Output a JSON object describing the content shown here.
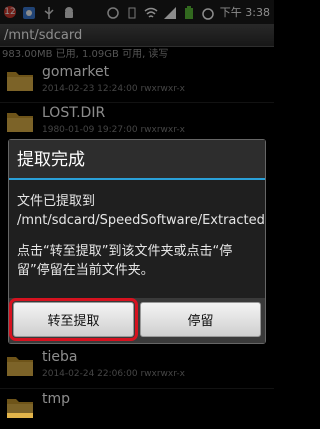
{
  "status_bar": {
    "notification_count": "12",
    "time": "下午 3:38",
    "icons": [
      "notification-badge-icon",
      "app-icon",
      "usb-icon",
      "android-icon",
      "sync-icon",
      "vibrate-icon",
      "wifi-icon",
      "signal-icon",
      "battery-icon",
      "alarm-icon"
    ]
  },
  "path": "/mnt/sdcard",
  "storage_info": "983.00MB 已用, 1.09GB 可用, 读写",
  "files": [
    {
      "name": "gomarket",
      "meta": "2014-02-23 12:24:00  rwxrwxr-x"
    },
    {
      "name": "LOST.DIR",
      "meta": "1980-01-09 19:27:00  rwxrwxr-x"
    },
    {
      "name": "tieba",
      "meta": "2014-02-24 22:06:00  rwxrwxr-x"
    },
    {
      "name": "tmp",
      "meta": ""
    }
  ],
  "dialog": {
    "title": "提取完成",
    "message_1": "文件已提取到 /mnt/sdcard/SpeedSoftware/Extracted",
    "message_2": "点击“转至提取”到该文件夹或点击“停留”停留在当前文件夹。",
    "btn_goto": "转至提取",
    "btn_stay": "停留"
  },
  "colors": {
    "accent": "#2aa0d8",
    "highlight": "#d6121f"
  }
}
